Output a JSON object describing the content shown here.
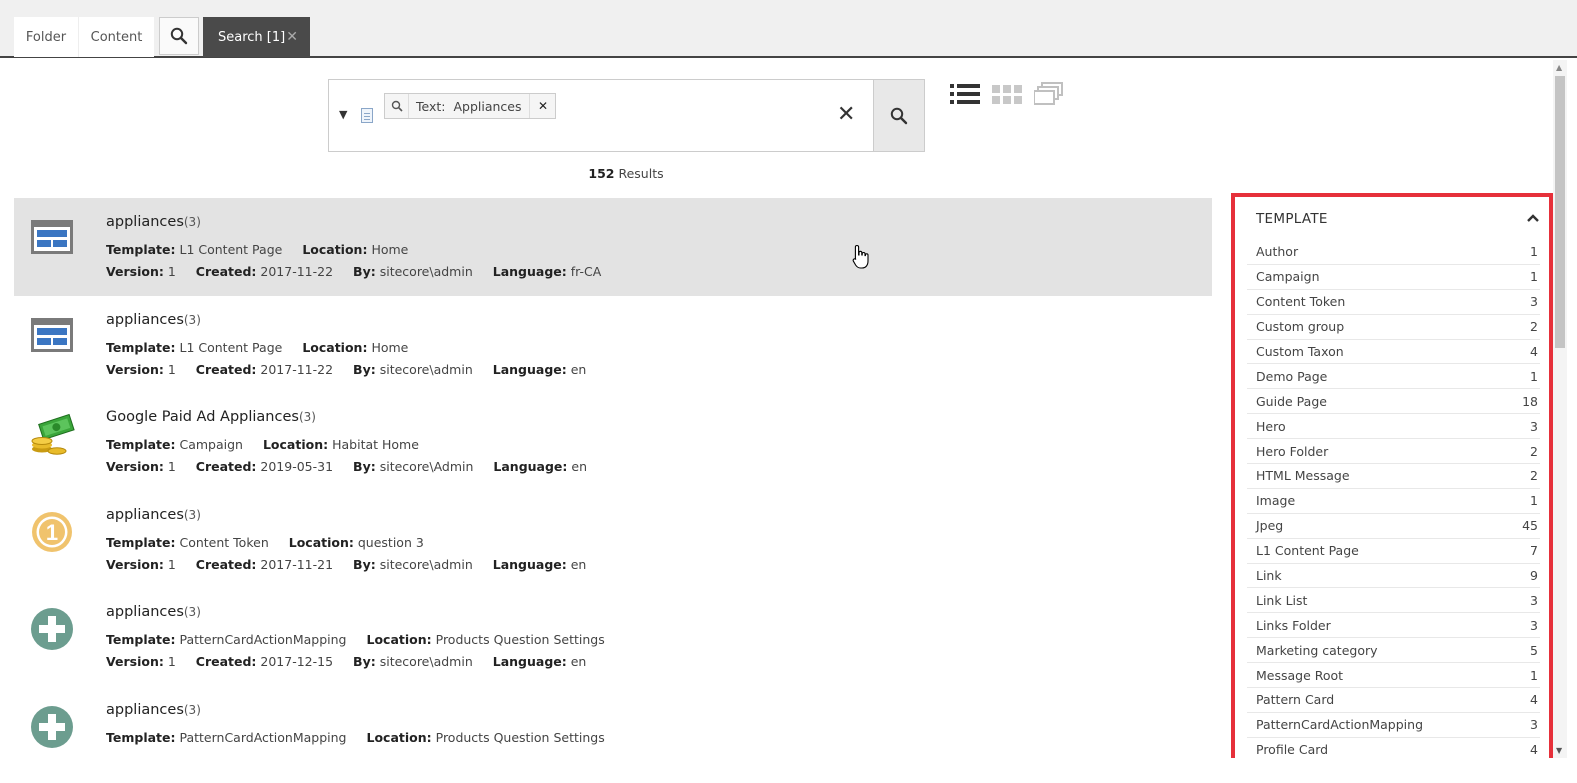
{
  "tabs": {
    "folder": "Folder",
    "content": "Content",
    "search": "Search [1]"
  },
  "search": {
    "chip_label": "Text:",
    "chip_value": "Appliances"
  },
  "results": {
    "count": "152",
    "label": "Results"
  },
  "labels": {
    "template": "Template:",
    "location": "Location:",
    "version": "Version:",
    "created": "Created:",
    "by": "By:",
    "language": "Language:"
  },
  "items": [
    {
      "title": "appliances",
      "count": "(3)",
      "template": "L1 Content Page",
      "location": "Home",
      "version": "1",
      "created": "2017-11-22",
      "by": "sitecore\\admin",
      "language": "fr-CA",
      "icon": "page-layout-icon"
    },
    {
      "title": "appliances",
      "count": "(3)",
      "template": "L1 Content Page",
      "location": "Home",
      "version": "1",
      "created": "2017-11-22",
      "by": "sitecore\\admin",
      "language": "en",
      "icon": "page-layout-icon"
    },
    {
      "title": "Google Paid Ad Appliances",
      "count": "(3)",
      "template": "Campaign",
      "location": "Habitat Home",
      "version": "1",
      "created": "2019-05-31",
      "by": "sitecore\\Admin",
      "language": "en",
      "icon": "money-campaign-icon"
    },
    {
      "title": "appliances",
      "count": "(3)",
      "template": "Content Token",
      "location": "question 3",
      "version": "1",
      "created": "2017-11-21",
      "by": "sitecore\\admin",
      "language": "en",
      "icon": "token-one-icon"
    },
    {
      "title": "appliances",
      "count": "(3)",
      "template": "PatternCardActionMapping",
      "location": "Products Question Settings",
      "version": "1",
      "created": "2017-12-15",
      "by": "sitecore\\admin",
      "language": "en",
      "icon": "plus-circle-icon"
    },
    {
      "title": "appliances",
      "count": "(3)",
      "template": "PatternCardActionMapping",
      "location": "Products Question Settings",
      "version": "",
      "created": "",
      "by": "",
      "language": "",
      "icon": "plus-circle-icon"
    }
  ],
  "facet": {
    "title": "TEMPLATE",
    "rows": [
      {
        "name": "Author",
        "count": "1"
      },
      {
        "name": "Campaign",
        "count": "1"
      },
      {
        "name": "Content Token",
        "count": "3"
      },
      {
        "name": "Custom group",
        "count": "2"
      },
      {
        "name": "Custom Taxon",
        "count": "4"
      },
      {
        "name": "Demo Page",
        "count": "1"
      },
      {
        "name": "Guide Page",
        "count": "18"
      },
      {
        "name": "Hero",
        "count": "3"
      },
      {
        "name": "Hero Folder",
        "count": "2"
      },
      {
        "name": "HTML Message",
        "count": "2"
      },
      {
        "name": "Image",
        "count": "1"
      },
      {
        "name": "Jpeg",
        "count": "45"
      },
      {
        "name": "L1 Content Page",
        "count": "7"
      },
      {
        "name": "Link",
        "count": "9"
      },
      {
        "name": "Link List",
        "count": "3"
      },
      {
        "name": "Links Folder",
        "count": "3"
      },
      {
        "name": "Marketing category",
        "count": "5"
      },
      {
        "name": "Message Root",
        "count": "1"
      },
      {
        "name": "Pattern Card",
        "count": "4"
      },
      {
        "name": "PatternCardActionMapping",
        "count": "3"
      },
      {
        "name": "Profile Card",
        "count": "4"
      }
    ]
  },
  "colors": {
    "highlight": "#e6303a",
    "active_tab": "#4a4a4a",
    "selected_row": "#e3e3e3"
  }
}
